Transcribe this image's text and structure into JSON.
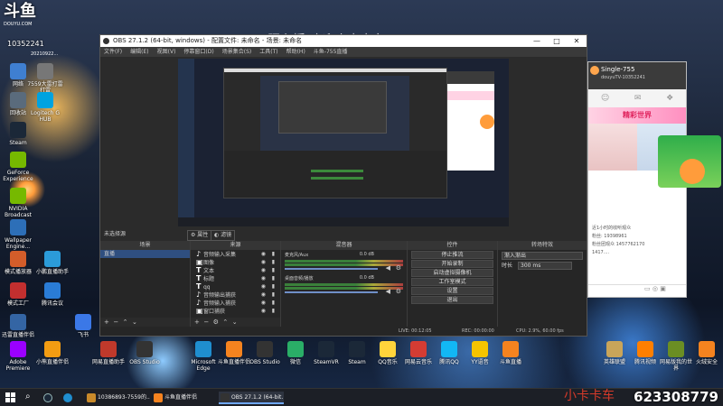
{
  "brand": {
    "logo": "斗鱼",
    "site": "DOUYU.COM",
    "room": "10352241",
    "date": "20210922..."
  },
  "overlay_text": "一照主播 欢迎小卡卡车",
  "desktop_icons": [
    {
      "label": "网络",
      "color": "#3f7fd1"
    },
    {
      "label": "7559大雷打雷打雷",
      "color": "#777"
    },
    {
      "label": "回收站",
      "color": "#5a6b7c"
    },
    {
      "label": "Logitech G HUB",
      "color": "#00a3e0"
    },
    {
      "label": "Steam",
      "color": "#1b2838"
    },
    {
      "label": "GeForce Experience",
      "color": "#76b900"
    },
    {
      "label": "NVIDIA Broadcast",
      "color": "#76b900"
    },
    {
      "label": "Wallpaper Engine...",
      "color": "#2d6fb8"
    },
    {
      "label": "模式播放器",
      "color": "#d35d2a"
    },
    {
      "label": "小鹏直播助手",
      "color": "#2b9bd9"
    },
    {
      "label": "模式工厂",
      "color": "#c22f2f"
    },
    {
      "label": "腾讯会议",
      "color": "#2a7cd6"
    },
    {
      "label": "迅雷直播伴侣",
      "color": "#3465a4"
    },
    {
      "label": "飞书",
      "color": "#3b78e7"
    },
    {
      "label": "游戏",
      "color": "#666"
    },
    {
      "label": "Adobe Premiere",
      "color": "#9a00ff"
    },
    {
      "label": "小熊直播伴侣",
      "color": "#f39c12"
    },
    {
      "label": "网易直播助手",
      "color": "#c0392b"
    },
    {
      "label": "OBS Studio",
      "color": "#333"
    }
  ],
  "taskbar_icons": [
    {
      "label": "Microsoft Edge",
      "color": "#1f8ecf"
    },
    {
      "label": "斗鱼直播伴侣",
      "color": "#f5831f"
    },
    {
      "label": "OBS Studio",
      "color": "#333"
    },
    {
      "label": "微信",
      "color": "#2aae67"
    },
    {
      "label": "SteamVR",
      "color": "#1b2838"
    },
    {
      "label": "Steam",
      "color": "#1b2838"
    },
    {
      "label": "QQ音乐",
      "color": "#ffd43b"
    },
    {
      "label": "网易云音乐",
      "color": "#d43c33"
    },
    {
      "label": "腾讯QQ",
      "color": "#12b7f5"
    },
    {
      "label": "YY语音",
      "color": "#f5c400"
    },
    {
      "label": "斗鱼直播",
      "color": "#f5831f"
    }
  ],
  "right_icons": [
    {
      "label": "英雄联盟",
      "color": "#c9a55a"
    },
    {
      "label": "腾讯视频",
      "color": "#ff7f00"
    },
    {
      "label": "网易版我的世界",
      "color": "#6b8e23"
    },
    {
      "label": "火绒安全",
      "color": "#f5831f"
    }
  ],
  "obs": {
    "title": "OBS 27.1.2 (64-bit, windows) - 配置文件: 未命名 - 场景: 未命名",
    "menu": [
      "文件(F)",
      "编辑(E)",
      "视图(V)",
      "停靠窗口(D)",
      "场景集合(S)",
      "工具(T)",
      "帮助(H)",
      "斗鱼-755直播"
    ],
    "no_source": "未选择源",
    "props_label": "属性",
    "filter_label": "滤镜",
    "docks": {
      "scenes": "场景",
      "sources": "来源",
      "mixer": "混音器",
      "controls": "控件",
      "transitions": "转场特效"
    },
    "scenes": [
      "直播"
    ],
    "sources": [
      {
        "icon": "♪",
        "label": "音频输入采集"
      },
      {
        "icon": "▣",
        "label": "图像"
      },
      {
        "icon": "T",
        "label": "文本"
      },
      {
        "icon": "T",
        "label": "标题"
      },
      {
        "icon": "T",
        "label": "qq"
      },
      {
        "icon": "♪",
        "label": "音频输出捕获"
      },
      {
        "icon": "♪",
        "label": "音频输入捕获"
      },
      {
        "icon": "▣",
        "label": "窗口捕获"
      }
    ],
    "mixer": [
      {
        "name": "麦克风/Aux",
        "db": "0.0 dB"
      },
      {
        "name": "桌面音频/播放",
        "db": "0.0 dB"
      }
    ],
    "controls": [
      "停止推流",
      "开始录制",
      "启动虚拟摄像机",
      "工作室模式",
      "设置",
      "退出"
    ],
    "transition": {
      "type": "渐入渐出",
      "duration_label": "时长",
      "duration": "300 ms"
    },
    "status": {
      "dropped": "0 (0.0%)",
      "live": "LIVE: 00:12:05",
      "rec": "REC: 00:00:00",
      "cpu": "CPU: 2.9%, 60.00 fps"
    }
  },
  "chat": {
    "name": "Single-755",
    "uid": "douyuTV-10352241",
    "banner": "精彩世界",
    "messages": [
      "近1小时的收听观众",
      "粉丝: 19398961",
      "粉丝团观众 1457762170",
      "1417...."
    ]
  },
  "taskbar": {
    "windows": [
      {
        "label": "10386893-7559的...",
        "color": "#c98a2a"
      },
      {
        "label": "斗鱼直播伴侣",
        "color": "#f5831f"
      },
      {
        "label": "OBS 27.1.2 (64-bit...",
        "color": "#333"
      }
    ],
    "red_text": "小卡卡车",
    "number": "623308779"
  }
}
